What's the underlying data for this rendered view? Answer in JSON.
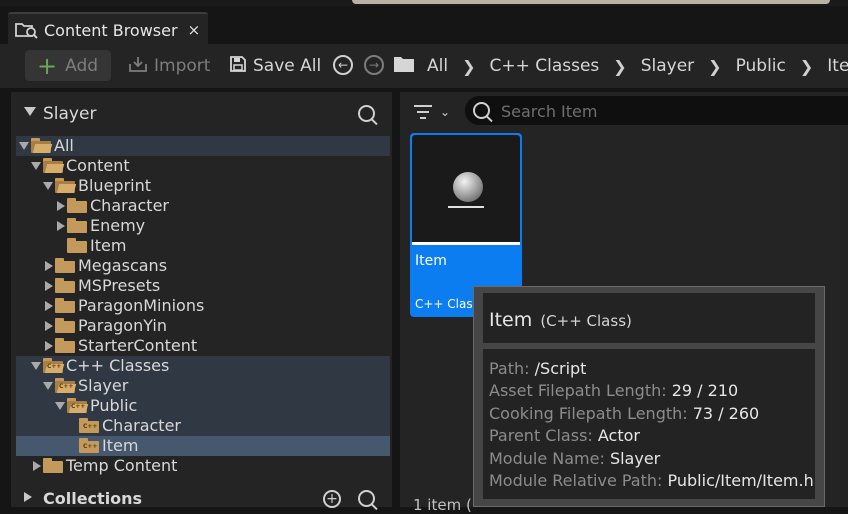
{
  "tab": {
    "title": "Content Browser",
    "close": "×"
  },
  "toolbar": {
    "add_label": "Add",
    "import_label": "Import",
    "save_all_label": "Save All",
    "breadcrumbs": [
      "All",
      "C++ Classes",
      "Slayer",
      "Public",
      "Item"
    ]
  },
  "sources": {
    "title": "Slayer",
    "tree": [
      {
        "label": "All",
        "depth": 0,
        "arrow": "down",
        "folder": "open",
        "state": "hl"
      },
      {
        "label": "Content",
        "depth": 1,
        "arrow": "down",
        "folder": "open",
        "state": ""
      },
      {
        "label": "Blueprint",
        "depth": 2,
        "arrow": "down",
        "folder": "open",
        "state": ""
      },
      {
        "label": "Character",
        "depth": 3,
        "arrow": "right",
        "folder": "closed",
        "state": ""
      },
      {
        "label": "Enemy",
        "depth": 3,
        "arrow": "right",
        "folder": "closed",
        "state": ""
      },
      {
        "label": "Item",
        "depth": 3,
        "arrow": "none",
        "folder": "closed",
        "state": ""
      },
      {
        "label": "Megascans",
        "depth": 2,
        "arrow": "right",
        "folder": "closed",
        "state": ""
      },
      {
        "label": "MSPresets",
        "depth": 2,
        "arrow": "right",
        "folder": "closed",
        "state": ""
      },
      {
        "label": "ParagonMinions",
        "depth": 2,
        "arrow": "right",
        "folder": "closed",
        "state": ""
      },
      {
        "label": "ParagonYin",
        "depth": 2,
        "arrow": "right",
        "folder": "closed",
        "state": ""
      },
      {
        "label": "StarterContent",
        "depth": 2,
        "arrow": "right",
        "folder": "closed",
        "state": ""
      },
      {
        "label": "C++ Classes",
        "depth": 1,
        "arrow": "down",
        "folder": "cpp-open",
        "state": "hl"
      },
      {
        "label": "Slayer",
        "depth": 2,
        "arrow": "down",
        "folder": "cpp-open",
        "state": "hl"
      },
      {
        "label": "Public",
        "depth": 3,
        "arrow": "down",
        "folder": "cpp-open",
        "state": "hl"
      },
      {
        "label": "Character",
        "depth": 4,
        "arrow": "none",
        "folder": "cpp",
        "state": "hl"
      },
      {
        "label": "Item",
        "depth": 4,
        "arrow": "none",
        "folder": "cpp",
        "state": "sel"
      },
      {
        "label": "Temp Content",
        "depth": 1,
        "arrow": "right",
        "folder": "closed",
        "state": ""
      }
    ],
    "collections_label": "Collections"
  },
  "assets": {
    "search_placeholder": "Search Item",
    "tile": {
      "name": "Item",
      "type": "C++ Class"
    },
    "item_count": "1 item ("
  },
  "tooltip": {
    "title": "Item",
    "subtitle": "(C++ Class)",
    "path_key": "Path:",
    "path_val": "/Script",
    "asset_len_key": "Asset Filepath Length:",
    "asset_len_val": "29 / 210",
    "cook_len_key": "Cooking Filepath Length:",
    "cook_len_val": "73 / 260",
    "parent_key": "Parent Class:",
    "parent_val": "Actor",
    "module_key": "Module Name:",
    "module_val": "Slayer",
    "relpath_key": "Module Relative Path:",
    "relpath_val": "Public/Item/Item.h"
  },
  "colors": {
    "panel_bg": "#242424",
    "selection_blue": "#0b7df1",
    "tree_selected": "#46586d",
    "tree_highlight": "#2f3843",
    "folder": "#c39a5c",
    "add_green": "#6ba35f"
  },
  "icons": {
    "tab": "content-browser-icon",
    "add": "plus-icon",
    "import": "import-icon",
    "save_all": "save-icon",
    "back": "back-arrow-icon",
    "forward": "forward-arrow-icon",
    "folder": "folder-icon",
    "search": "search-icon",
    "filter": "filter-icon",
    "add_collection": "plus-circle-icon",
    "asset": "actor-class-icon"
  }
}
